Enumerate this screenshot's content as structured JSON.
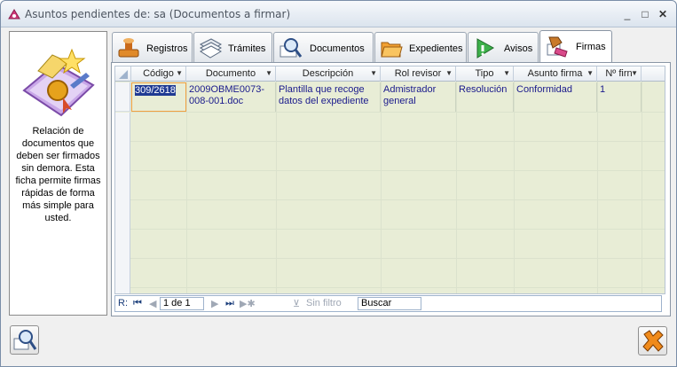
{
  "window": {
    "title": "Asuntos pendientes de: sa (Documentos a firmar)",
    "minimize": "_",
    "maximize": "□",
    "close": "✕"
  },
  "left_panel": {
    "icon": "certificate-stamp-icon",
    "description": "Relación de documentos que deben ser firmados sin demora. Esta ficha permite firmas rápidas de forma más simple para usted."
  },
  "tabs": [
    {
      "label": "Registros",
      "icon": "stamp-icon",
      "active": false
    },
    {
      "label": "Trámites",
      "icon": "document-stack-icon",
      "active": false
    },
    {
      "label": "Documentos",
      "icon": "magnifier-document-icon",
      "active": false
    },
    {
      "label": "Expedientes",
      "icon": "folder-icon",
      "active": false
    },
    {
      "label": "Avisos",
      "icon": "warning-triangle-icon",
      "active": false
    },
    {
      "label": "Firmas",
      "icon": "signature-stamp-icon",
      "active": true
    }
  ],
  "table": {
    "columns": [
      "Código",
      "Documento",
      "Descripción",
      "Rol revisor",
      "Tipo",
      "Asunto firma",
      "Nº firn"
    ],
    "rows": [
      {
        "codigo": "309/2618",
        "documento": "2009OBME0073-008-001.doc",
        "descripcion": "Plantilla que recoge datos del expediente",
        "rol_revisor": "Admistrador general",
        "tipo": "Resolución",
        "asunto_firma": "Conformidad",
        "num_firma": "1"
      }
    ]
  },
  "navigator": {
    "record_label": "R:",
    "position": "1 de 1",
    "filter_label": "Sin filtro",
    "search_label": "Buscar"
  },
  "colors": {
    "grid_background": "#e8edd6",
    "selected_cell": "#1f3a93",
    "text_blue": "#1a1a8c"
  }
}
